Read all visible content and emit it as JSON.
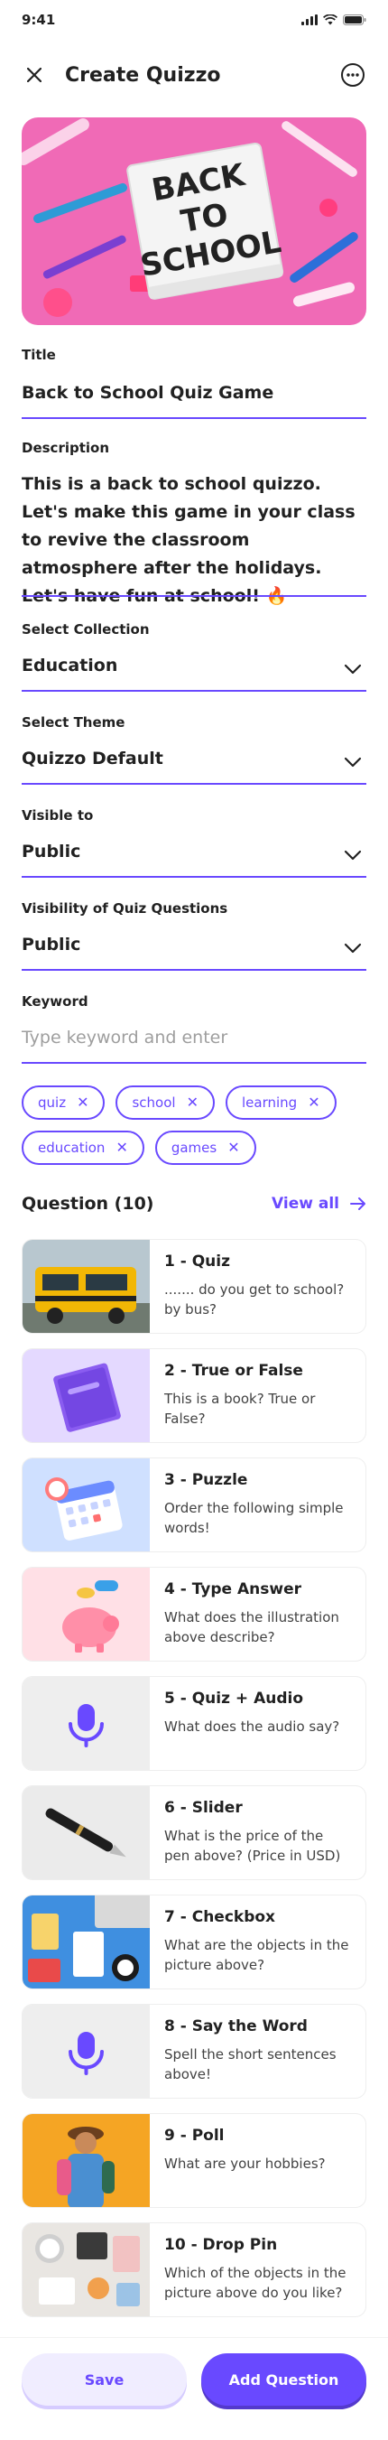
{
  "status": {
    "time": "9:41"
  },
  "header": {
    "title": "Create Quizzo"
  },
  "cover": {
    "board_lines": [
      "BACK",
      "TO",
      "SCHOOL"
    ]
  },
  "form": {
    "title_label": "Title",
    "title_value": "Back to School Quiz Game",
    "description_label": "Description",
    "description_value": "This is a back to school quizzo. Let's make this game in your class to revive the classroom atmosphere after the holidays. Let's have fun at school! 🔥",
    "collection_label": "Select Collection",
    "collection_value": "Education",
    "theme_label": "Select Theme",
    "theme_value": "Quizzo Default",
    "visible_label": "Visible to",
    "visible_value": "Public",
    "visibility_q_label": "Visibility of Quiz Questions",
    "visibility_q_value": "Public",
    "keyword_label": "Keyword",
    "keyword_placeholder": "Type keyword and enter"
  },
  "keywords": [
    "quiz",
    "school",
    "learning",
    "education",
    "games"
  ],
  "questions_header": {
    "title": "Question (10)",
    "view_all": "View all"
  },
  "questions": [
    {
      "name": "1 - Quiz",
      "text": "....... do you get to school? by bus?"
    },
    {
      "name": "2 - True or False",
      "text": "This is a book? True or False?"
    },
    {
      "name": "3 - Puzzle",
      "text": "Order the following simple words!"
    },
    {
      "name": "4 - Type Answer",
      "text": "What does the illustration above describe?"
    },
    {
      "name": "5 - Quiz + Audio",
      "text": "What does the audio say?"
    },
    {
      "name": "6 - Slider",
      "text": "What is the price of the pen above? (Price in USD)"
    },
    {
      "name": "7 - Checkbox",
      "text": "What are the objects in the picture above?"
    },
    {
      "name": "8 - Say the Word",
      "text": "Spell the short sentences above!"
    },
    {
      "name": "9 - Poll",
      "text": "What are your hobbies?"
    },
    {
      "name": "10 - Drop Pin",
      "text": "Which of the objects in the picture above do you like?"
    }
  ],
  "buttons": {
    "save": "Save",
    "add_question": "Add Question"
  },
  "colors": {
    "primary": "#6949ff",
    "primary_light": "#f0edff",
    "text": "#212121",
    "placeholder": "#9e9e9e"
  }
}
